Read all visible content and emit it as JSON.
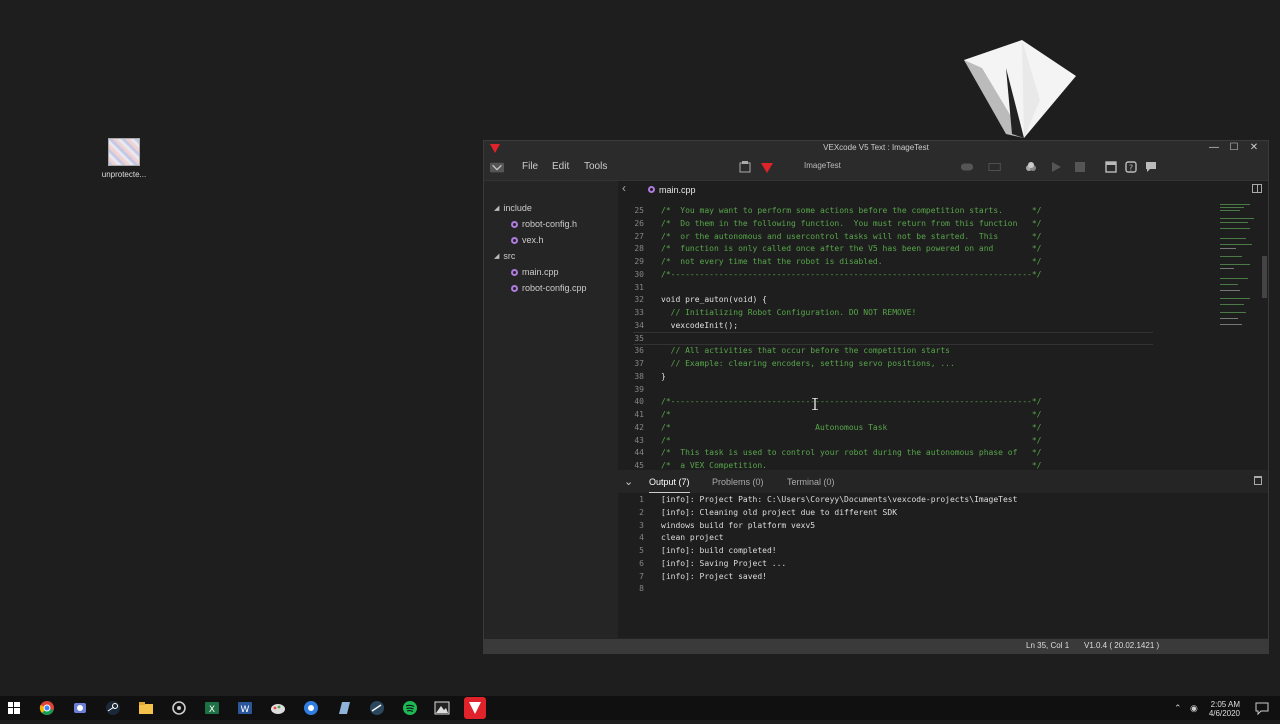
{
  "desktop": {
    "icon_label": "unprotecte..."
  },
  "window": {
    "title": "VEXcode V5 Text : ImageTest",
    "controls": {
      "minimize": "—",
      "maximize": "☐",
      "close": "✕"
    }
  },
  "menu": {
    "file": "File",
    "edit": "Edit",
    "tools": "Tools",
    "project_name": "ImageTest"
  },
  "tabs": {
    "active_file": "main.cpp",
    "back": "‹"
  },
  "sidebar": {
    "folders": [
      {
        "name": "include",
        "files": [
          "robot-config.h",
          "vex.h"
        ]
      },
      {
        "name": "src",
        "files": [
          "main.cpp",
          "robot-config.cpp"
        ]
      }
    ]
  },
  "editor": {
    "cursor_line": 35,
    "lines": [
      {
        "n": "25",
        "t": "/*  You may want to perform some actions before the competition starts.      */",
        "k": "cm"
      },
      {
        "n": "26",
        "t": "/*  Do them in the following function.  You must return from this function   */",
        "k": "cm"
      },
      {
        "n": "27",
        "t": "/*  or the autonomous and usercontrol tasks will not be started.  This       */",
        "k": "cm"
      },
      {
        "n": "28",
        "t": "/*  function is only called once after the V5 has been powered on and        */",
        "k": "cm"
      },
      {
        "n": "29",
        "t": "/*  not every time that the robot is disabled.                               */",
        "k": "cm"
      },
      {
        "n": "30",
        "t": "/*---------------------------------------------------------------------------*/",
        "k": "cm"
      },
      {
        "n": "31",
        "t": "",
        "k": "pl"
      },
      {
        "n": "32",
        "t": "void pre_auton(void) {",
        "k": "pl"
      },
      {
        "n": "33",
        "t": "  // Initializing Robot Configuration. DO NOT REMOVE!",
        "k": "cm"
      },
      {
        "n": "34",
        "t": "  vexcodeInit();",
        "k": "pl"
      },
      {
        "n": "35",
        "t": "",
        "k": "pl"
      },
      {
        "n": "36",
        "t": "  // All activities that occur before the competition starts",
        "k": "cm"
      },
      {
        "n": "37",
        "t": "  // Example: clearing encoders, setting servo positions, ...",
        "k": "cm"
      },
      {
        "n": "38",
        "t": "}",
        "k": "pl"
      },
      {
        "n": "39",
        "t": "",
        "k": "pl"
      },
      {
        "n": "40",
        "t": "/*---------------------------------------------------------------------------*/",
        "k": "cm"
      },
      {
        "n": "41",
        "t": "/*                                                                           */",
        "k": "cm"
      },
      {
        "n": "42",
        "t": "/*                              Autonomous Task                              */",
        "k": "cm"
      },
      {
        "n": "43",
        "t": "/*                                                                           */",
        "k": "cm"
      },
      {
        "n": "44",
        "t": "/*  This task is used to control your robot during the autonomous phase of   */",
        "k": "cm"
      },
      {
        "n": "45",
        "t": "/*  a VEX Competition.                                                       */",
        "k": "cm"
      }
    ]
  },
  "panel": {
    "tabs": [
      "Output (7)",
      "Problems (0)",
      "Terminal (0)"
    ],
    "output": [
      {
        "n": "1",
        "t": "[info]: Project Path: C:\\Users\\Coreyy\\Documents\\vexcode-projects\\ImageTest"
      },
      {
        "n": "2",
        "t": "[info]: Cleaning old project due to different SDK"
      },
      {
        "n": "3",
        "t": "windows build for platform vexv5"
      },
      {
        "n": "4",
        "t": "clean project"
      },
      {
        "n": "5",
        "t": "[info]: build completed!"
      },
      {
        "n": "6",
        "t": "[info]: Saving Project ..."
      },
      {
        "n": "7",
        "t": "[info]: Project saved!"
      },
      {
        "n": "8",
        "t": ""
      }
    ]
  },
  "status": {
    "position": "Ln 35, Col 1",
    "version": "V1.0.4 ( 20.02.1421 )"
  },
  "taskbar": {
    "time": "2:05 AM",
    "date": "4/6/2020"
  },
  "colors": {
    "accent": "#e0222a",
    "comment": "#57a64a",
    "keyword": "#569cd6"
  }
}
